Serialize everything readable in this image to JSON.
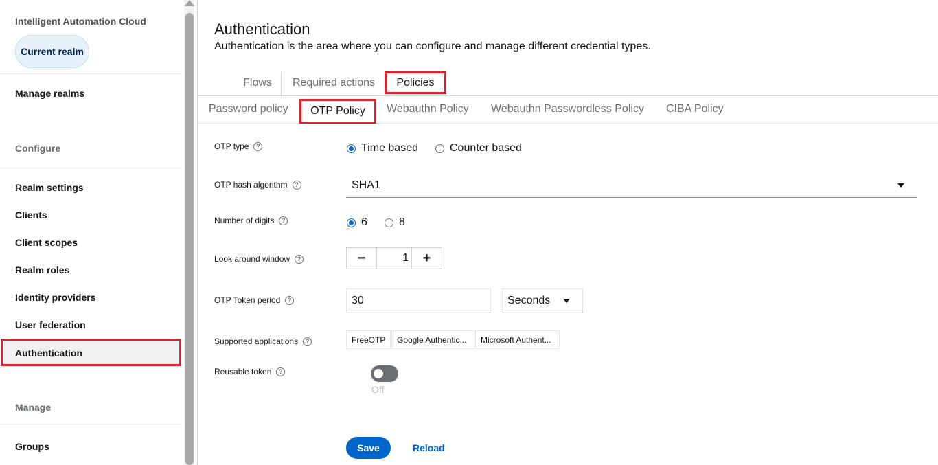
{
  "sidebar": {
    "app_title": "Intelligent Automation Cloud",
    "realm_button": "Current realm",
    "manage_realms": "Manage realms",
    "section_configure": "Configure",
    "items_configure": [
      "Realm settings",
      "Clients",
      "Client scopes",
      "Realm roles",
      "Identity providers",
      "User federation",
      "Authentication"
    ],
    "section_manage": "Manage",
    "items_manage": [
      "Groups"
    ]
  },
  "header": {
    "title": "Authentication",
    "description": "Authentication is the area where you can configure and manage different credential types."
  },
  "tabs": [
    "Flows",
    "Required actions",
    "Policies"
  ],
  "subtabs": [
    "Password policy",
    "OTP Policy",
    "Webauthn Policy",
    "Webauthn Passwordless Policy",
    "CIBA Policy"
  ],
  "form": {
    "otp_type": {
      "label": "OTP type",
      "options": [
        "Time based",
        "Counter based"
      ],
      "selected": "Time based"
    },
    "hash_algorithm": {
      "label": "OTP hash algorithm",
      "value": "SHA1"
    },
    "digits": {
      "label": "Number of digits",
      "options": [
        "6",
        "8"
      ],
      "selected": "6"
    },
    "look_around": {
      "label": "Look around window",
      "value": "1",
      "minus": "−",
      "plus": "+"
    },
    "token_period": {
      "label": "OTP Token period",
      "value": "30",
      "unit": "Seconds"
    },
    "supported_apps": {
      "label": "Supported applications",
      "apps": [
        "FreeOTP",
        "Google Authentic...",
        "Microsoft Authent..."
      ]
    },
    "reusable_token": {
      "label": "Reusable token",
      "state": "Off"
    }
  },
  "actions": {
    "save": "Save",
    "reload": "Reload"
  },
  "colors": {
    "accent": "#0066cc",
    "highlight": "#e0202a"
  },
  "icons": {
    "help": "help-circle-icon",
    "caret": "caret-down-icon"
  }
}
